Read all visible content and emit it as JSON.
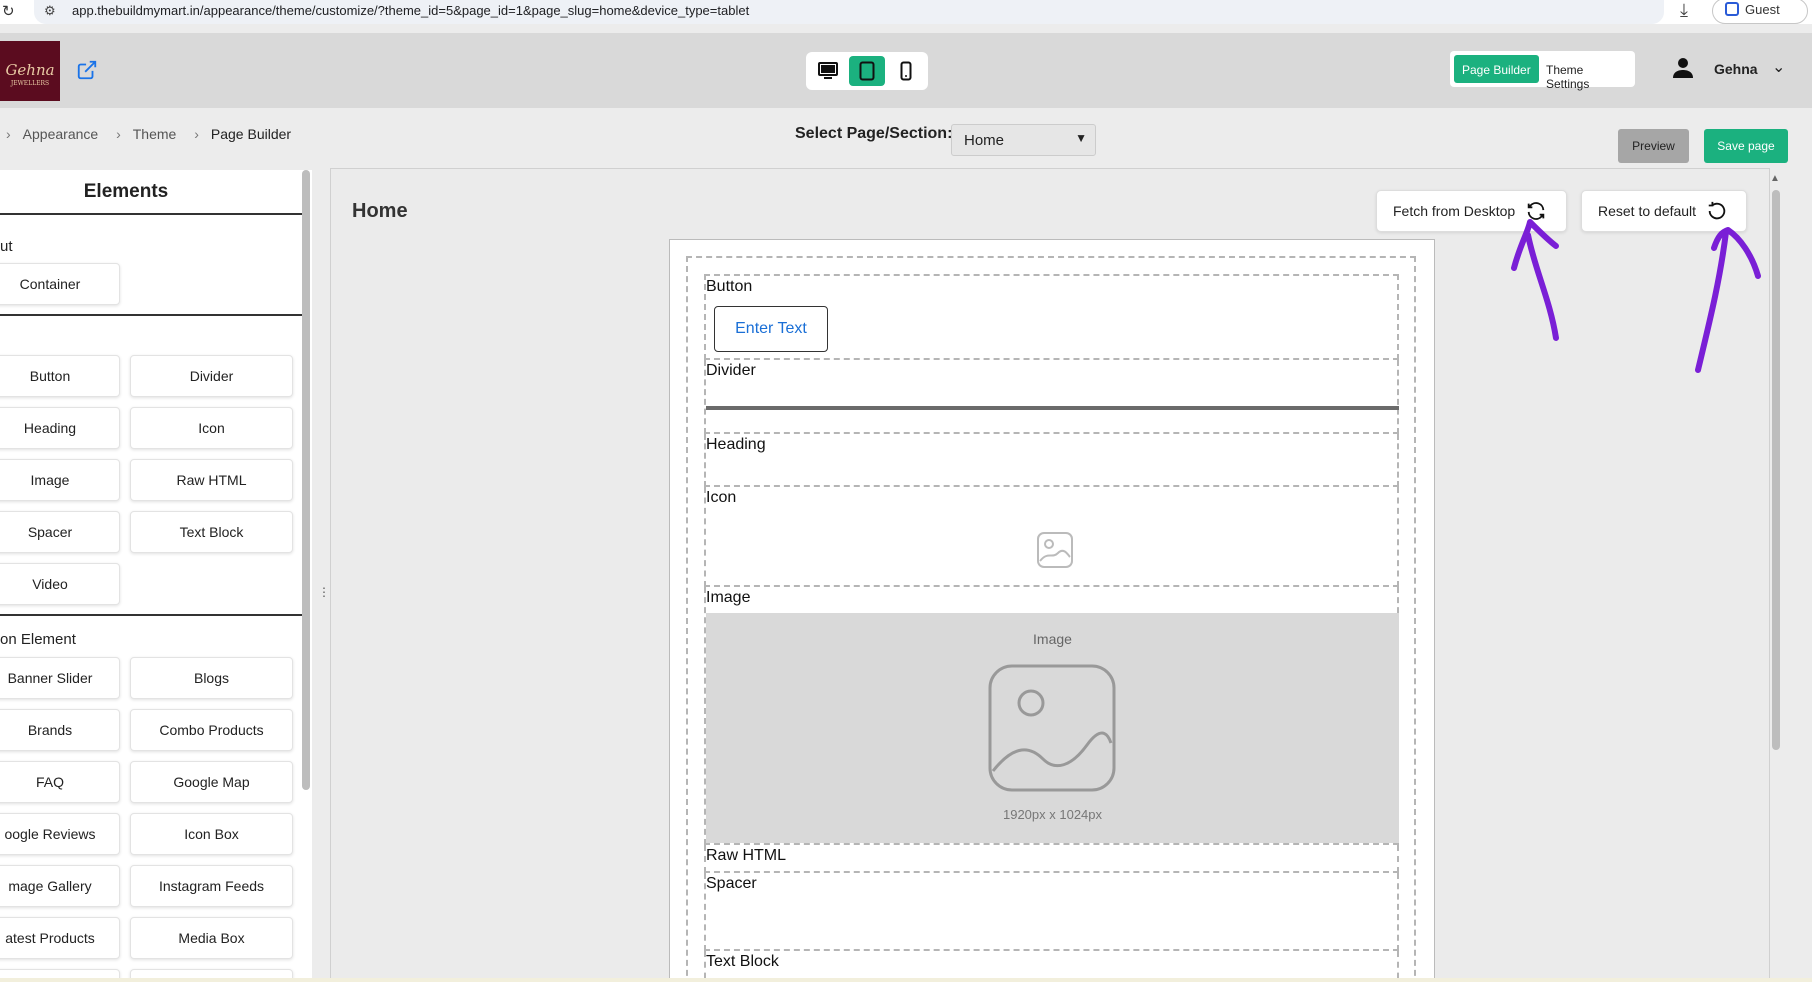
{
  "browser": {
    "url": "app.thebuildmymart.in/appearance/theme/customize/?theme_id=5&page_id=1&page_slug=home&device_type=tablet",
    "guest_label": "Guest"
  },
  "header": {
    "logo_text": "Gehna",
    "logo_sub": "JEWELLERS",
    "mode_active": "Page Builder",
    "mode_other": "Theme Settings",
    "username": "Gehna"
  },
  "breadcrumb": {
    "items": [
      "Appearance",
      "Theme",
      "Page Builder"
    ]
  },
  "toolbar": {
    "select_label": "Select Page/Section:",
    "select_value": "Home",
    "preview_label": "Preview",
    "save_label": "Save page"
  },
  "elements_panel": {
    "title": "Elements",
    "layout_label": "ut",
    "layout_items": [
      "Container"
    ],
    "basic_items": [
      "Button",
      "Divider",
      "Heading",
      "Icon",
      "Image",
      "Raw HTML",
      "Spacer",
      "Text Block",
      "Video"
    ],
    "section_label": "on Element",
    "section_items": [
      "Banner Slider",
      "Blogs",
      "Brands",
      "Combo Products",
      "FAQ",
      "Google Map",
      "oogle Reviews",
      "Icon Box",
      "mage Gallery",
      "Instagram Feeds",
      "atest Products",
      "Media Box"
    ]
  },
  "canvas": {
    "page_title": "Home",
    "fetch_label": "Fetch from Desktop",
    "reset_label": "Reset to default",
    "blocks": {
      "button_label": "Button",
      "button_text": "Enter Text",
      "divider_label": "Divider",
      "heading_label": "Heading",
      "icon_label": "Icon",
      "image_label": "Image",
      "image_placeholder_label": "Image",
      "image_size": "1920px x 1024px",
      "rawhtml_label": "Raw HTML",
      "spacer_label": "Spacer",
      "textblock_label": "Text Block"
    }
  },
  "colors": {
    "accent": "#1bb17f",
    "annotation": "#7a1fd6",
    "logo_bg": "#5b0c1f"
  }
}
